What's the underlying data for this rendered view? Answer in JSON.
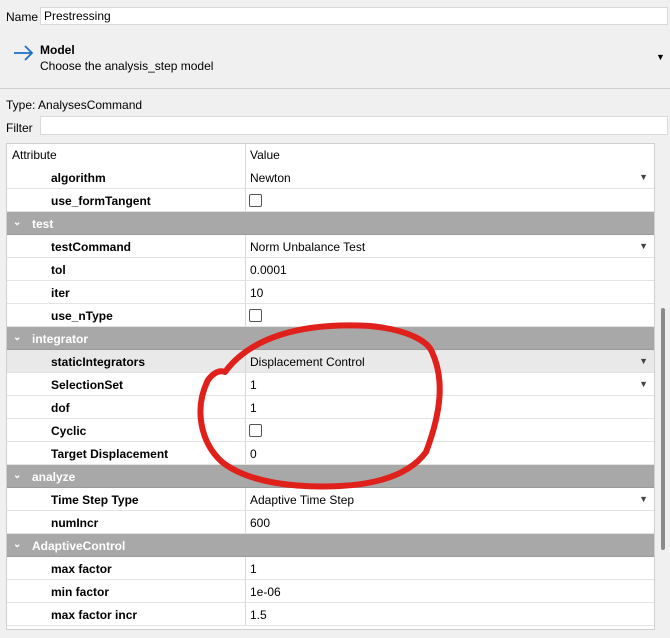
{
  "name": {
    "label": "Name",
    "value": "Prestressing"
  },
  "model": {
    "title": "Model",
    "description": "Choose the analysis_step model",
    "icon": "arrow-right-icon"
  },
  "type_text": "Type: AnalysesCommand",
  "filter": {
    "label": "Filter",
    "value": ""
  },
  "table": {
    "headers": {
      "attribute": "Attribute",
      "value": "Value"
    },
    "rows": [
      {
        "kind": "field",
        "attr": "algorithm",
        "value": "Newton",
        "control": "dropdown"
      },
      {
        "kind": "field",
        "attr": "use_formTangent",
        "value": "",
        "control": "checkbox"
      },
      {
        "kind": "group",
        "label": "test"
      },
      {
        "kind": "field",
        "attr": "testCommand",
        "value": "Norm Unbalance Test",
        "control": "dropdown"
      },
      {
        "kind": "field",
        "attr": "tol",
        "value": "0.0001",
        "control": "text"
      },
      {
        "kind": "field",
        "attr": "iter",
        "value": "10",
        "control": "text"
      },
      {
        "kind": "field",
        "attr": "use_nType",
        "value": "",
        "control": "checkbox"
      },
      {
        "kind": "group",
        "label": "integrator"
      },
      {
        "kind": "field",
        "attr": "staticIntegrators",
        "value": "Displacement Control",
        "control": "dropdown",
        "highlight": true
      },
      {
        "kind": "field",
        "attr": "SelectionSet",
        "value": "1",
        "control": "dropdown"
      },
      {
        "kind": "field",
        "attr": "dof",
        "value": "1",
        "control": "text"
      },
      {
        "kind": "field",
        "attr": "Cyclic",
        "value": "",
        "control": "checkbox"
      },
      {
        "kind": "field",
        "attr": "Target Displacement",
        "value": "0",
        "control": "text"
      },
      {
        "kind": "group",
        "label": "analyze"
      },
      {
        "kind": "field",
        "attr": "Time Step Type",
        "value": "Adaptive Time Step",
        "control": "dropdown"
      },
      {
        "kind": "field",
        "attr": "numIncr",
        "value": "600",
        "control": "text"
      },
      {
        "kind": "group",
        "label": "AdaptiveControl"
      },
      {
        "kind": "field",
        "attr": "max factor",
        "value": "1",
        "control": "text"
      },
      {
        "kind": "field",
        "attr": "min factor",
        "value": "1e-06",
        "control": "text"
      },
      {
        "kind": "field",
        "attr": "max factor incr",
        "value": "1.5",
        "control": "text"
      }
    ]
  },
  "colors": {
    "group_header": "#a8a8a8",
    "annotation": "#e0201b",
    "accent": "#1e6fc4"
  }
}
